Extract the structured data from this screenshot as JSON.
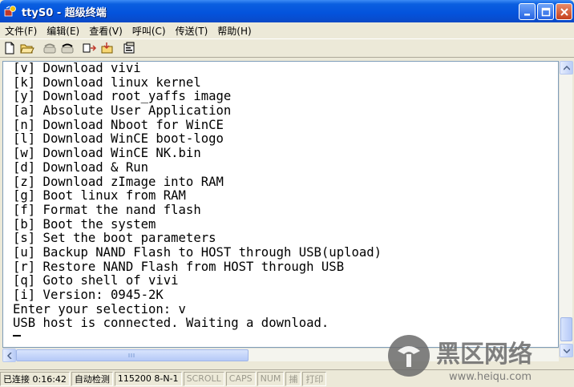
{
  "window": {
    "title": "ttyS0 - 超级终端",
    "controls": {
      "minimize": "minimize-icon",
      "maximize": "maximize-icon",
      "close": "close-icon"
    }
  },
  "menu": [
    {
      "label": "文件(F)"
    },
    {
      "label": "编辑(E)"
    },
    {
      "label": "查看(V)"
    },
    {
      "label": "呼叫(C)"
    },
    {
      "label": "传送(T)"
    },
    {
      "label": "帮助(H)"
    }
  ],
  "toolbar": {
    "icons": [
      "new-document-icon",
      "open-folder-icon",
      "connect-phone-icon",
      "disconnect-phone-icon",
      "send-file-icon",
      "receive-file-icon",
      "properties-icon"
    ]
  },
  "terminal": {
    "lines": [
      "[v] Download vivi",
      "[k] Download linux kernel",
      "[y] Download root_yaffs image",
      "[a] Absolute User Application",
      "[n] Download Nboot for WinCE",
      "[l] Download WinCE boot-logo",
      "[w] Download WinCE NK.bin",
      "[d] Download & Run",
      "[z] Download zImage into RAM",
      "[g] Boot linux from RAM",
      "[f] Format the nand flash",
      "[b] Boot the system",
      "[s] Set the boot parameters",
      "[u] Backup NAND Flash to HOST through USB(upload)",
      "[r] Restore NAND Flash from HOST through USB",
      "[q] Goto shell of vivi",
      "[i] Version: 0945-2K",
      "Enter your selection: v",
      "USB host is connected. Waiting a download."
    ]
  },
  "status": {
    "connected": "已连接 0:16:42",
    "detect": "自动检测",
    "baud": "115200 8-N-1",
    "scroll": "SCROLL",
    "caps": "CAPS",
    "num": "NUM",
    "capture": "捕",
    "print": "打印"
  },
  "watermark": {
    "brand": "黑区网络",
    "url": "www.heiqu.com"
  },
  "colors": {
    "titlebar": "#0453dc",
    "terminal_bg": "#ffffff",
    "terminal_fg": "#000000",
    "chrome": "#ece9d8"
  }
}
